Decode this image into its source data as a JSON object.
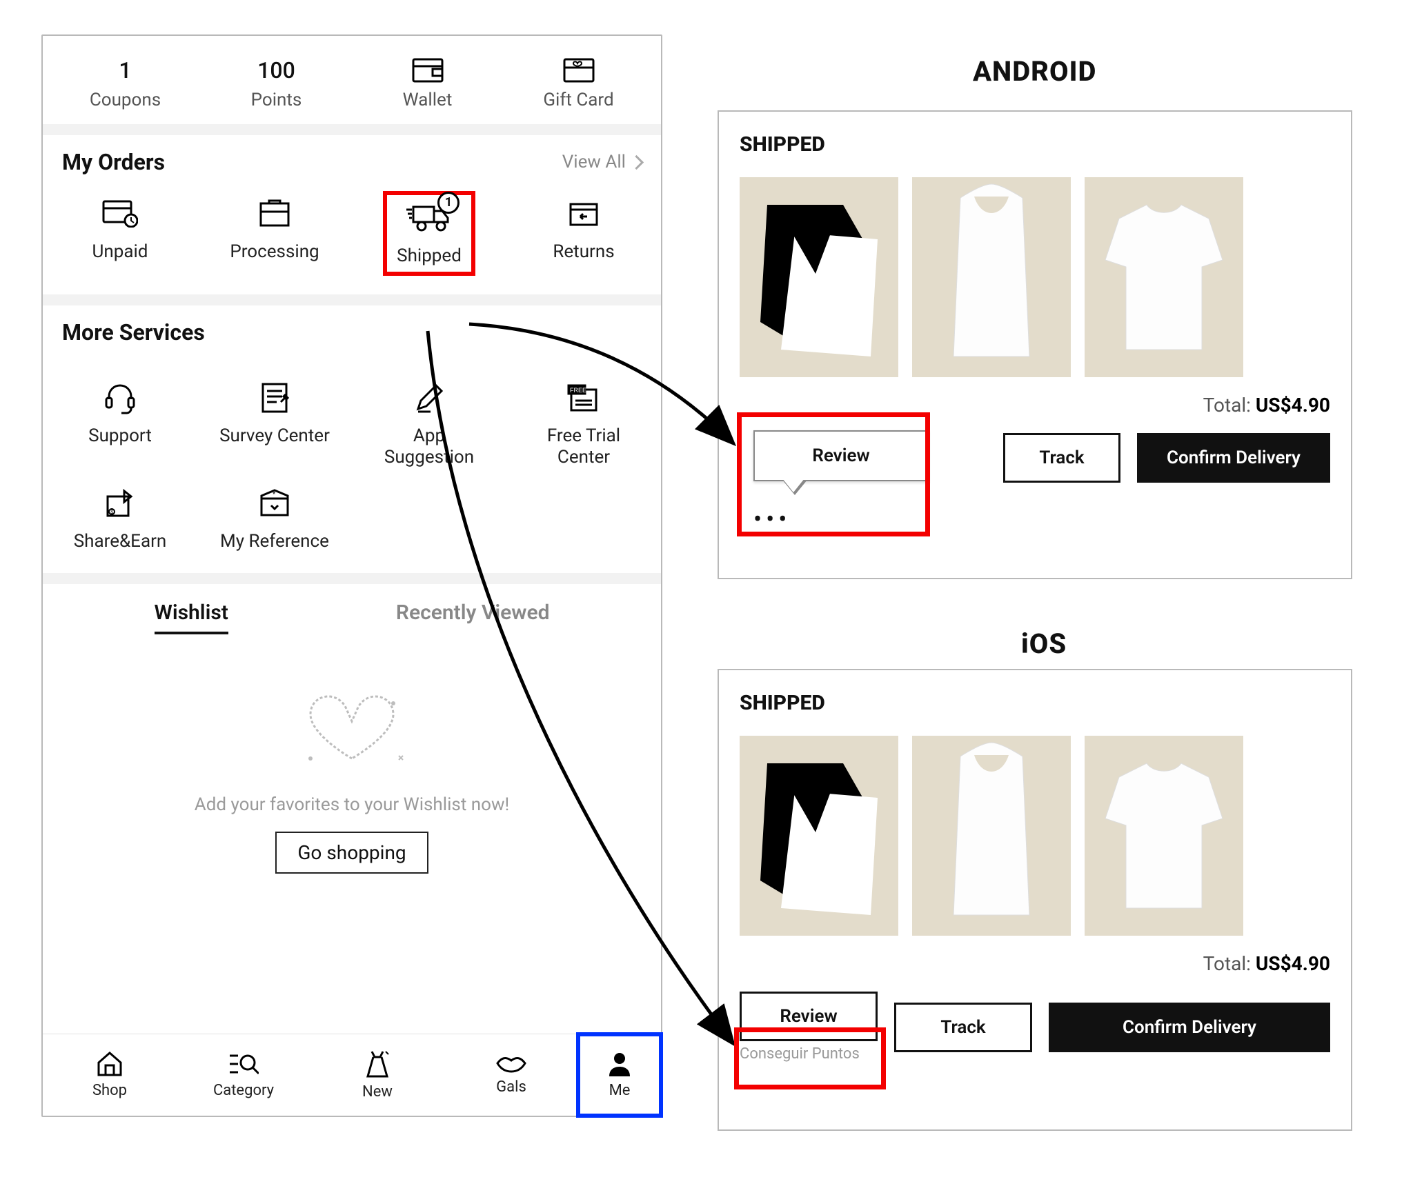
{
  "stats": {
    "coupons": {
      "value": "1",
      "label": "Coupons"
    },
    "points": {
      "value": "100",
      "label": "Points"
    },
    "wallet": {
      "label": "Wallet"
    },
    "giftcard": {
      "label": "Gift Card"
    }
  },
  "my_orders": {
    "title": "My Orders",
    "view_all": "View All",
    "unpaid": "Unpaid",
    "processing": "Processing",
    "shipped": "Shipped",
    "shipped_badge": "1",
    "returns": "Returns"
  },
  "more_services": {
    "title": "More Services",
    "support": "Support",
    "survey_center": "Survey Center",
    "app_suggestion": "App\nSuggestion",
    "free_trial": "Free Trial\nCenter",
    "share_earn": "Share&Earn",
    "my_reference": "My Reference"
  },
  "tabs": {
    "wishlist": "Wishlist",
    "recently_viewed": "Recently Viewed"
  },
  "wishlist_empty": {
    "caption": "Add your favorites to your Wishlist now!",
    "cta": "Go shopping"
  },
  "bottom_nav": {
    "shop": "Shop",
    "category": "Category",
    "new": "New",
    "gals": "Gals",
    "me": "Me"
  },
  "right": {
    "android_title": "ANDROID",
    "ios_title": "iOS",
    "status": "SHIPPED",
    "total_label": "Total:",
    "total_value": "US$4.90",
    "review": "Review",
    "track": "Track",
    "confirm_delivery": "Confirm Delivery",
    "ios_subtext": "Conseguir Puntos"
  }
}
